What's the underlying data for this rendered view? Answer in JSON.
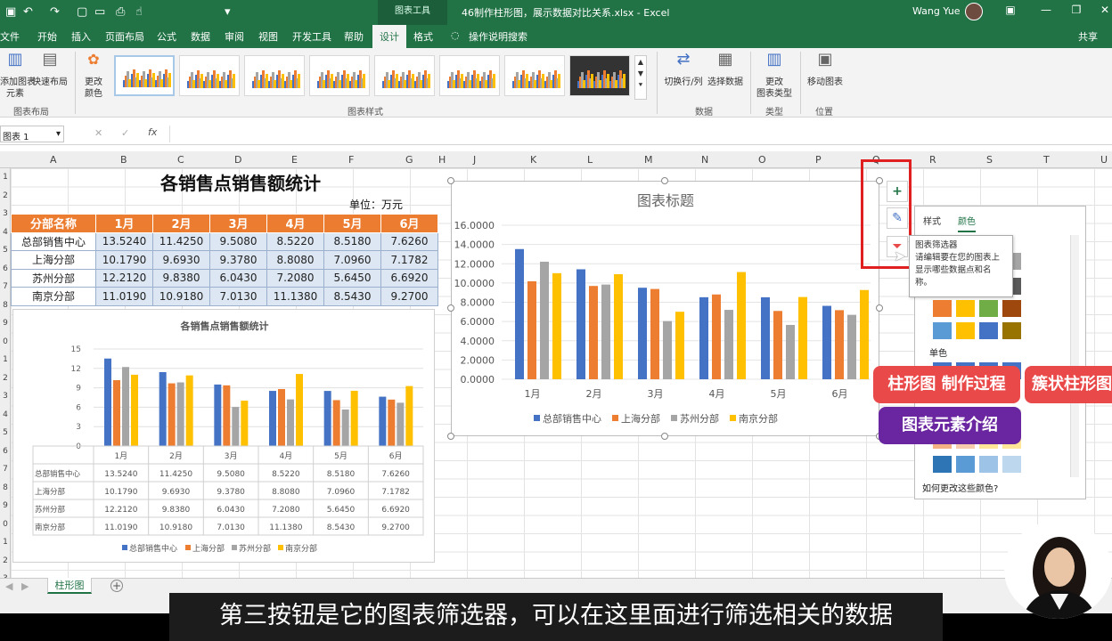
{
  "titlebar": {
    "context_tab": "图表工具",
    "doc_title": "46制作柱形图，展示数据对比关系.xlsx - Excel",
    "user": "Wang Yue"
  },
  "tabs": [
    "文件",
    "开始",
    "插入",
    "页面布局",
    "公式",
    "数据",
    "审阅",
    "视图",
    "开发工具",
    "帮助",
    "设计",
    "格式"
  ],
  "tellme": "操作说明搜索",
  "share": "共享",
  "ribbon": {
    "add_element": "添加图表\n元素",
    "quick_layout": "快速布局",
    "change_colors": "更改\n颜色",
    "group_layout": "图表布局",
    "group_styles": "图表样式",
    "switch_rowcol": "切换行/列",
    "select_data": "选择数据",
    "group_data": "数据",
    "change_type": "更改\n图表类型",
    "group_type": "类型",
    "move_chart": "移动图表",
    "group_location": "位置"
  },
  "formula": {
    "namebox": "图表 1",
    "fx": "fx"
  },
  "columns": [
    "A",
    "B",
    "C",
    "D",
    "E",
    "F",
    "G",
    "H",
    "J",
    "K",
    "L",
    "M",
    "N",
    "O",
    "P",
    "Q",
    "R",
    "S",
    "T",
    "U"
  ],
  "rows": [
    "1",
    "2",
    "3",
    "4",
    "5",
    "6",
    "7",
    "8",
    "9",
    "0",
    "1",
    "2",
    "3",
    "4",
    "5",
    "6",
    "7",
    "8",
    "9",
    "0",
    "1",
    "2",
    "3"
  ],
  "sheet": {
    "title": "各销售点销售额统计",
    "unit": "单位：万元",
    "header": [
      "分部名称",
      "1月",
      "2月",
      "3月",
      "4月",
      "5月",
      "6月"
    ],
    "rows": [
      [
        "总部销售中心",
        "13.5240",
        "11.4250",
        "9.5080",
        "8.5220",
        "8.5180",
        "7.6260"
      ],
      [
        "上海分部",
        "10.1790",
        "9.6930",
        "9.3780",
        "8.8080",
        "7.0960",
        "7.1782"
      ],
      [
        "苏州分部",
        "12.2120",
        "9.8380",
        "6.0430",
        "7.2080",
        "5.6450",
        "6.6920"
      ],
      [
        "南京分部",
        "11.0190",
        "10.9180",
        "7.0130",
        "11.1380",
        "8.5430",
        "9.2700"
      ]
    ]
  },
  "chart_data": [
    {
      "type": "bar",
      "title": "各销售点销售额统计",
      "categories": [
        "1月",
        "2月",
        "3月",
        "4月",
        "5月",
        "6月"
      ],
      "ylim": [
        0,
        15
      ],
      "yticks": [
        0,
        3,
        6,
        9,
        12,
        15
      ],
      "legend": "bottom",
      "data_table": true,
      "series": [
        {
          "name": "总部销售中心",
          "values": [
            13.524,
            11.425,
            9.508,
            8.522,
            8.518,
            7.626
          ]
        },
        {
          "name": "上海分部",
          "values": [
            10.179,
            9.693,
            9.378,
            8.808,
            7.096,
            7.1782
          ]
        },
        {
          "name": "苏州分部",
          "values": [
            12.212,
            9.838,
            6.043,
            7.208,
            5.645,
            6.692
          ]
        },
        {
          "name": "南京分部",
          "values": [
            11.019,
            10.918,
            7.013,
            11.138,
            8.543,
            9.27
          ]
        }
      ]
    },
    {
      "type": "bar",
      "title": "图表标题",
      "categories": [
        "1月",
        "2月",
        "3月",
        "4月",
        "5月",
        "6月"
      ],
      "ylim": [
        0,
        16
      ],
      "yticks": [
        "0.0000",
        "2.0000",
        "4.0000",
        "6.0000",
        "8.0000",
        "10.0000",
        "12.0000",
        "14.0000",
        "16.0000"
      ],
      "legend": "bottom",
      "series": [
        {
          "name": "总部销售中心",
          "values": [
            13.524,
            11.425,
            9.508,
            8.522,
            8.518,
            7.626
          ]
        },
        {
          "name": "上海分部",
          "values": [
            10.179,
            9.693,
            9.378,
            8.808,
            7.096,
            7.1782
          ]
        },
        {
          "name": "苏州分部",
          "values": [
            12.212,
            9.838,
            6.043,
            7.208,
            5.645,
            6.692
          ]
        },
        {
          "name": "南京分部",
          "values": [
            11.019,
            10.918,
            7.013,
            11.138,
            8.543,
            9.27
          ]
        }
      ]
    }
  ],
  "colors": {
    "series": [
      "#4472c4",
      "#ed7d31",
      "#a5a5a5",
      "#ffc000"
    ],
    "excel_green": "#217346"
  },
  "side": {
    "plus": "+",
    "tooltip_title": "图表筛选器",
    "tooltip_body": "请编辑要在您的图表上显示哪些数据点和名称。"
  },
  "pane": {
    "tab_style": "样式",
    "tab_color": "颜色",
    "mono": "单色",
    "footer": "如何更改这些颜色?"
  },
  "sheettab": "柱形图",
  "overlays": {
    "a": "柱形图 制作过程",
    "b": "簇状柱形图",
    "c": "图表元素介绍"
  },
  "subtitle": "第三按钮是它的图表筛选器，可以在这里面进行筛选相关的数据"
}
